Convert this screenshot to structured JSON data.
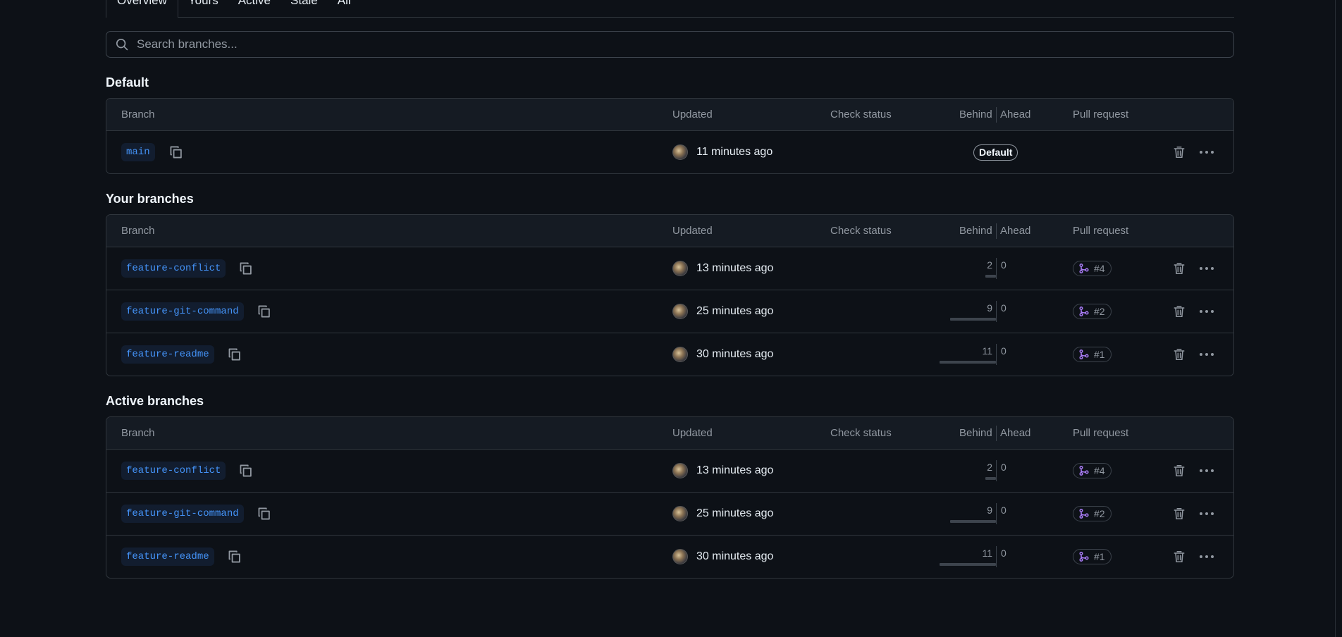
{
  "tabs": [
    {
      "label": "Overview",
      "active": true
    },
    {
      "label": "Yours"
    },
    {
      "label": "Active"
    },
    {
      "label": "Stale"
    },
    {
      "label": "All"
    }
  ],
  "search": {
    "placeholder": "Search branches..."
  },
  "columns": {
    "branch": "Branch",
    "updated": "Updated",
    "check": "Check status",
    "behind": "Behind",
    "ahead": "Ahead",
    "pr": "Pull request"
  },
  "sections": {
    "default": {
      "title": "Default",
      "rows": [
        {
          "branch": "main",
          "updated": "11 minutes ago",
          "badge": "Default"
        }
      ]
    },
    "yours": {
      "title": "Your branches",
      "rows": [
        {
          "branch": "feature-conflict",
          "updated": "13 minutes ago",
          "behind": "2",
          "ahead": "0",
          "pr": "#4"
        },
        {
          "branch": "feature-git-command",
          "updated": "25 minutes ago",
          "behind": "9",
          "ahead": "0",
          "pr": "#2"
        },
        {
          "branch": "feature-readme",
          "updated": "30 minutes ago",
          "behind": "11",
          "ahead": "0",
          "pr": "#1"
        }
      ]
    },
    "active": {
      "title": "Active branches",
      "rows": [
        {
          "branch": "feature-conflict",
          "updated": "13 minutes ago",
          "behind": "2",
          "ahead": "0",
          "pr": "#4"
        },
        {
          "branch": "feature-git-command",
          "updated": "25 minutes ago",
          "behind": "9",
          "ahead": "0",
          "pr": "#2"
        },
        {
          "branch": "feature-readme",
          "updated": "30 minutes ago",
          "behind": "11",
          "ahead": "0",
          "pr": "#1"
        }
      ]
    }
  },
  "colors": {
    "background": "#0d1117",
    "branch_link": "#4493f8",
    "pr_icon": "#ab7df8",
    "border": "#30363d"
  }
}
